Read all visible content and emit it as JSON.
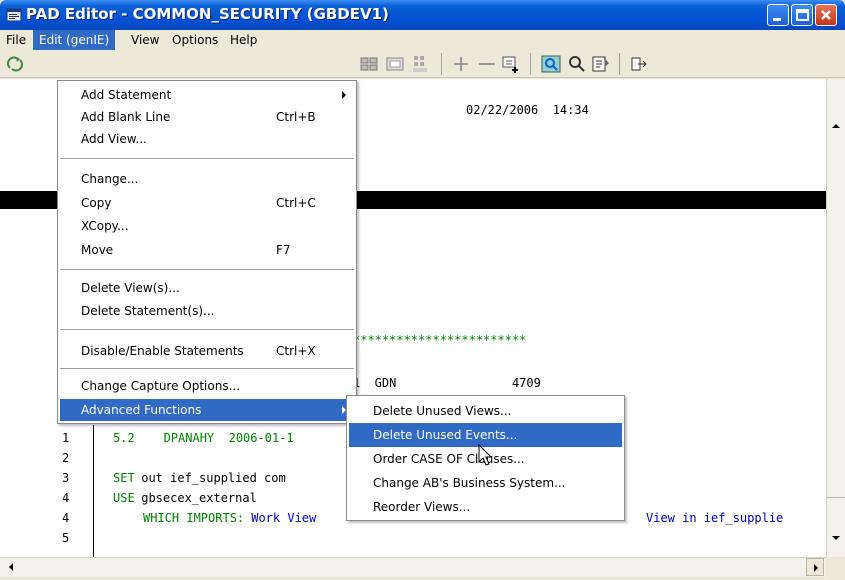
{
  "window": {
    "title": "PAD Editor - COMMON_SECURITY (GBDEV1)"
  },
  "menubar": {
    "items": [
      "File",
      "Edit (genIE)",
      "View",
      "Options",
      "Help"
    ]
  },
  "editor": {
    "timestamp_line": "02/22/2006  14:34",
    "stars_line": "************************",
    "gdn_line": "1  GDN                4709",
    "row1_num": "1",
    "row1_text": "5.2    DPANAHY  2006-01-1",
    "row2_num": "2",
    "row3_num": "3",
    "row3_kw": "SET",
    "row3_text": " out ief_supplied com",
    "row4a_num": "4",
    "row4a_kw": "USE",
    "row4a_text": " gbsecex_external",
    "row4b_num": "4",
    "row4b_kw": "WHICH IMPORTS:",
    "row4b_text": " Work View ",
    "row4b_tail": "View in ief_supplie",
    "row5_num": "5"
  },
  "edit_menu": {
    "items": [
      {
        "label": "Add Statement",
        "shortcut": "",
        "submenu": true
      },
      {
        "label": "Add Blank Line",
        "shortcut": "Ctrl+B"
      },
      {
        "label": "Add View...",
        "shortcut": ""
      },
      {
        "label": "Change...",
        "shortcut": ""
      },
      {
        "label": "Copy",
        "shortcut": "Ctrl+C"
      },
      {
        "label": "XCopy...",
        "shortcut": ""
      },
      {
        "label": "Move",
        "shortcut": "F7"
      },
      {
        "label": "Delete View(s)...",
        "shortcut": ""
      },
      {
        "label": "Delete Statement(s)...",
        "shortcut": ""
      },
      {
        "label": "Disable/Enable Statements",
        "shortcut": "Ctrl+X"
      },
      {
        "label": "Change Capture Options...",
        "shortcut": ""
      },
      {
        "label": "Advanced Functions",
        "shortcut": "",
        "submenu": true
      }
    ]
  },
  "advanced_submenu": {
    "items": [
      "Delete Unused Views...",
      "Delete Unused Events...",
      "Order CASE OF Clauses...",
      "Change AB's Business System...",
      "Reorder Views..."
    ]
  },
  "colors": {
    "title_blue": "#0550d3",
    "highlight": "#316ac5",
    "keyword_green": "#008000",
    "view_blue": "#0000c0"
  }
}
